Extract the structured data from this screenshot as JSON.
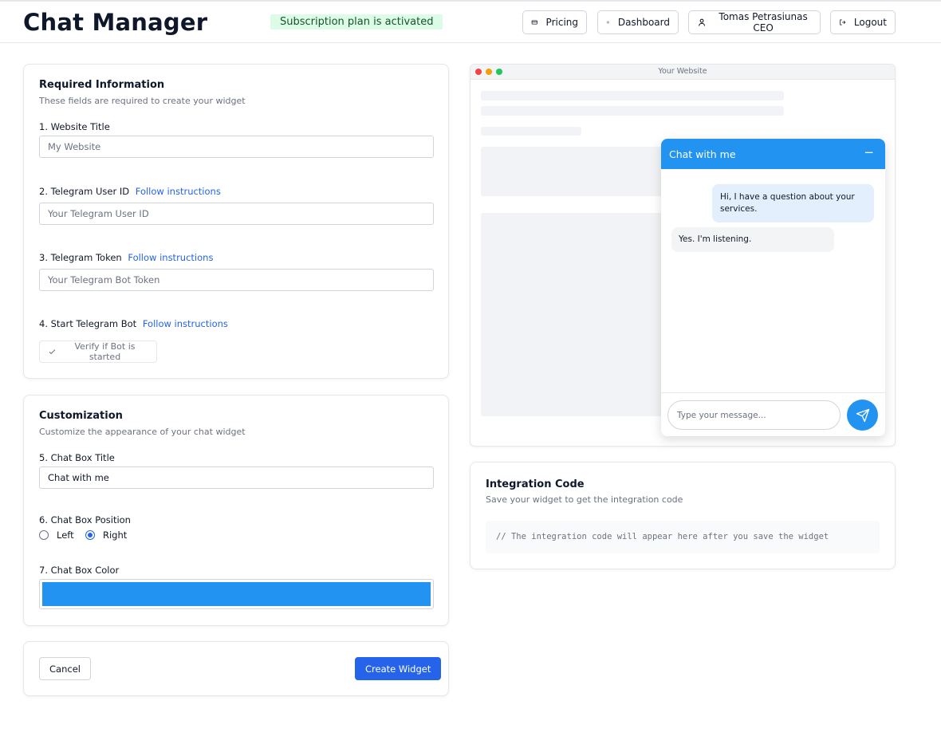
{
  "header": {
    "brand": "Chat Manager",
    "subscription_badge": "Subscription plan is activated",
    "nav": {
      "pricing": "Pricing",
      "dashboard": "Dashboard",
      "user": "Tomas Petrasiunas CEO",
      "logout": "Logout"
    }
  },
  "required": {
    "title": "Required Information",
    "subtitle": "These fields are required to create your widget",
    "website_title_label": "1. Website Title",
    "website_title_placeholder": "My Website",
    "telegram_user_label": "2. Telegram User ID",
    "telegram_user_link": "Follow instructions",
    "telegram_user_placeholder": "Your Telegram User ID",
    "telegram_token_label": "3. Telegram Token",
    "telegram_token_link": "Follow instructions",
    "telegram_token_placeholder": "Your Telegram Bot Token",
    "start_bot_label": "4. Start Telegram Bot",
    "start_bot_link": "Follow instructions",
    "verify_button": "Verify if Bot is started"
  },
  "customization": {
    "title": "Customization",
    "subtitle": "Customize the appearance of your chat widget",
    "chat_title_label": "5. Chat Box Title",
    "chat_title_value": "Chat with me",
    "position_label": "6. Chat Box Position",
    "position_left": "Left",
    "position_right": "Right",
    "position_selected": "Right",
    "color_label": "7. Chat Box Color",
    "color_value": "#2293f0"
  },
  "actions": {
    "cancel": "Cancel",
    "create": "Create Widget"
  },
  "preview": {
    "browser_title": "Your Website",
    "chat_header": "Chat with me",
    "minimize_symbol": "−",
    "messages": [
      {
        "from": "visitor",
        "text": "Hi, I have a question about your services."
      },
      {
        "from": "owner",
        "text": "Yes. I'm listening."
      }
    ],
    "input_placeholder": "Type your message..."
  },
  "integration": {
    "title": "Integration Code",
    "subtitle": "Save your widget to get the integration code",
    "code_placeholder": "// The integration code will appear here after you save the widget"
  },
  "colors": {
    "primary_button": "#2563eb",
    "chat_accent": "#2293f0",
    "badge_bg": "#dcfce7",
    "link": "#2563eb"
  },
  "icons": {
    "pricing": "credit-card-icon",
    "dashboard": "gear-icon",
    "user": "user-icon",
    "logout": "logout-icon",
    "verify": "check-icon",
    "send": "send-icon"
  }
}
